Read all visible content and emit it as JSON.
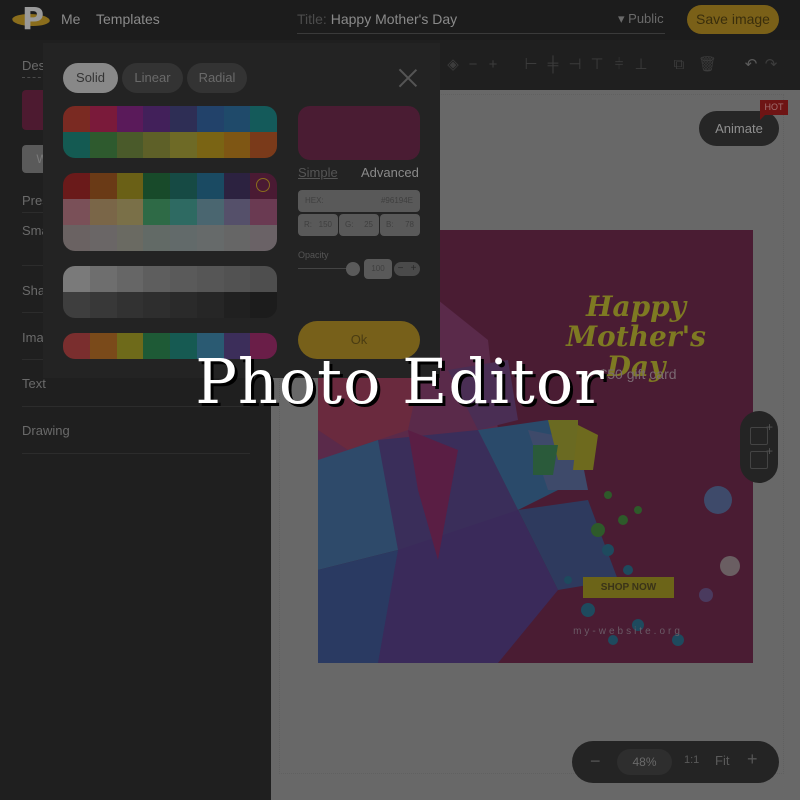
{
  "app": {
    "logo_letter": "P",
    "nav": [
      "Me",
      "Templates"
    ],
    "title_label": "Title:",
    "title_value": "Happy Mother's Day",
    "visibility": "Public",
    "save_label": "Save image"
  },
  "sidebar": {
    "tab": "Design",
    "button_partial": "W",
    "items": [
      "Presets",
      "Smart",
      "Shapes",
      "Images",
      "Text",
      "Drawing"
    ]
  },
  "toolbar": {
    "icons": [
      "transparency-icon",
      "minus-icon",
      "plus-icon",
      "align-left-icon",
      "align-center-h-icon",
      "align-right-icon",
      "align-top-icon",
      "align-middle-v-icon",
      "align-bottom-icon",
      "duplicate-icon",
      "delete-icon",
      "undo-icon",
      "redo-icon"
    ]
  },
  "canvas": {
    "animate_label": "Animate",
    "hot_badge": "HOT",
    "poster": {
      "headline_line1": "Happy",
      "headline_line2": "Mother's Day",
      "subtitle": "$50 gift card",
      "cta": "SHOP NOW",
      "website": "my-website.org",
      "background_color": "#96194E"
    }
  },
  "zoom": {
    "minus": "−",
    "value": "48%",
    "one_to_one": "1:1",
    "fit": "Fit",
    "plus": "+"
  },
  "color_picker": {
    "tabs": [
      {
        "label": "Solid",
        "active": true
      },
      {
        "label": "Linear",
        "active": false
      },
      {
        "label": "Radial",
        "active": false
      }
    ],
    "palettes": [
      [
        "#7a2a22",
        "#7a1a3a",
        "#5a1a5a",
        "#42205a",
        "#2e2e55",
        "#22426a",
        "#1f4a6a",
        "#145a5a",
        "#145a52",
        "#2e5a2e",
        "#4a5a2a",
        "#5e6028",
        "#6e6a26",
        "#7a6414",
        "#7e5614",
        "#7a3a1a"
      ],
      [
        "#6a1a1a",
        "#6a3a16",
        "#6a6016",
        "#184a2a",
        "#164a44",
        "#1a4a62",
        "#2c2240",
        "#4a1a33",
        "#7a5058",
        "#7a6648",
        "#7a7048",
        "#2e6a46",
        "#2e6a62",
        "#4a6670",
        "#55506a",
        "#6a3a52",
        "#6a6262",
        "#6a6666",
        "#6a6a62",
        "#626a66",
        "#626a6a",
        "#666a6a",
        "#666666",
        "#6a6266"
      ],
      [
        "#7a7a7a",
        "#6e6e6e",
        "#666666",
        "#5e5e5e",
        "#5a5a5a",
        "#565656",
        "#525252",
        "#4e4e4e",
        "#3e3e3e",
        "#383838",
        "#323232",
        "#2e2e2e",
        "#2a2a2a",
        "#262626",
        "#202020",
        "#1c1c1c"
      ],
      [
        "#7a2e2e",
        "#7a4a1a",
        "#6e6a1a",
        "#1e5a36",
        "#165a52",
        "#2a5a72",
        "#3c2e5a",
        "#6a1e48"
      ]
    ],
    "selected_swatch": "#96194E",
    "mode_simple": "Simple",
    "mode_advanced": "Advanced",
    "hex_label": "HEX:",
    "hex_value": "#96194E",
    "r_label": "R:",
    "r_value": "150",
    "g_label": "G:",
    "g_value": "25",
    "b_label": "B:",
    "b_value": "78",
    "opacity_label": "Opacity",
    "opacity_value": "100",
    "opacity_fraction": 1.0,
    "stepper_minus": "−",
    "stepper_plus": "+",
    "ok_label": "Ok"
  },
  "overlay_title": "Photo Editor"
}
